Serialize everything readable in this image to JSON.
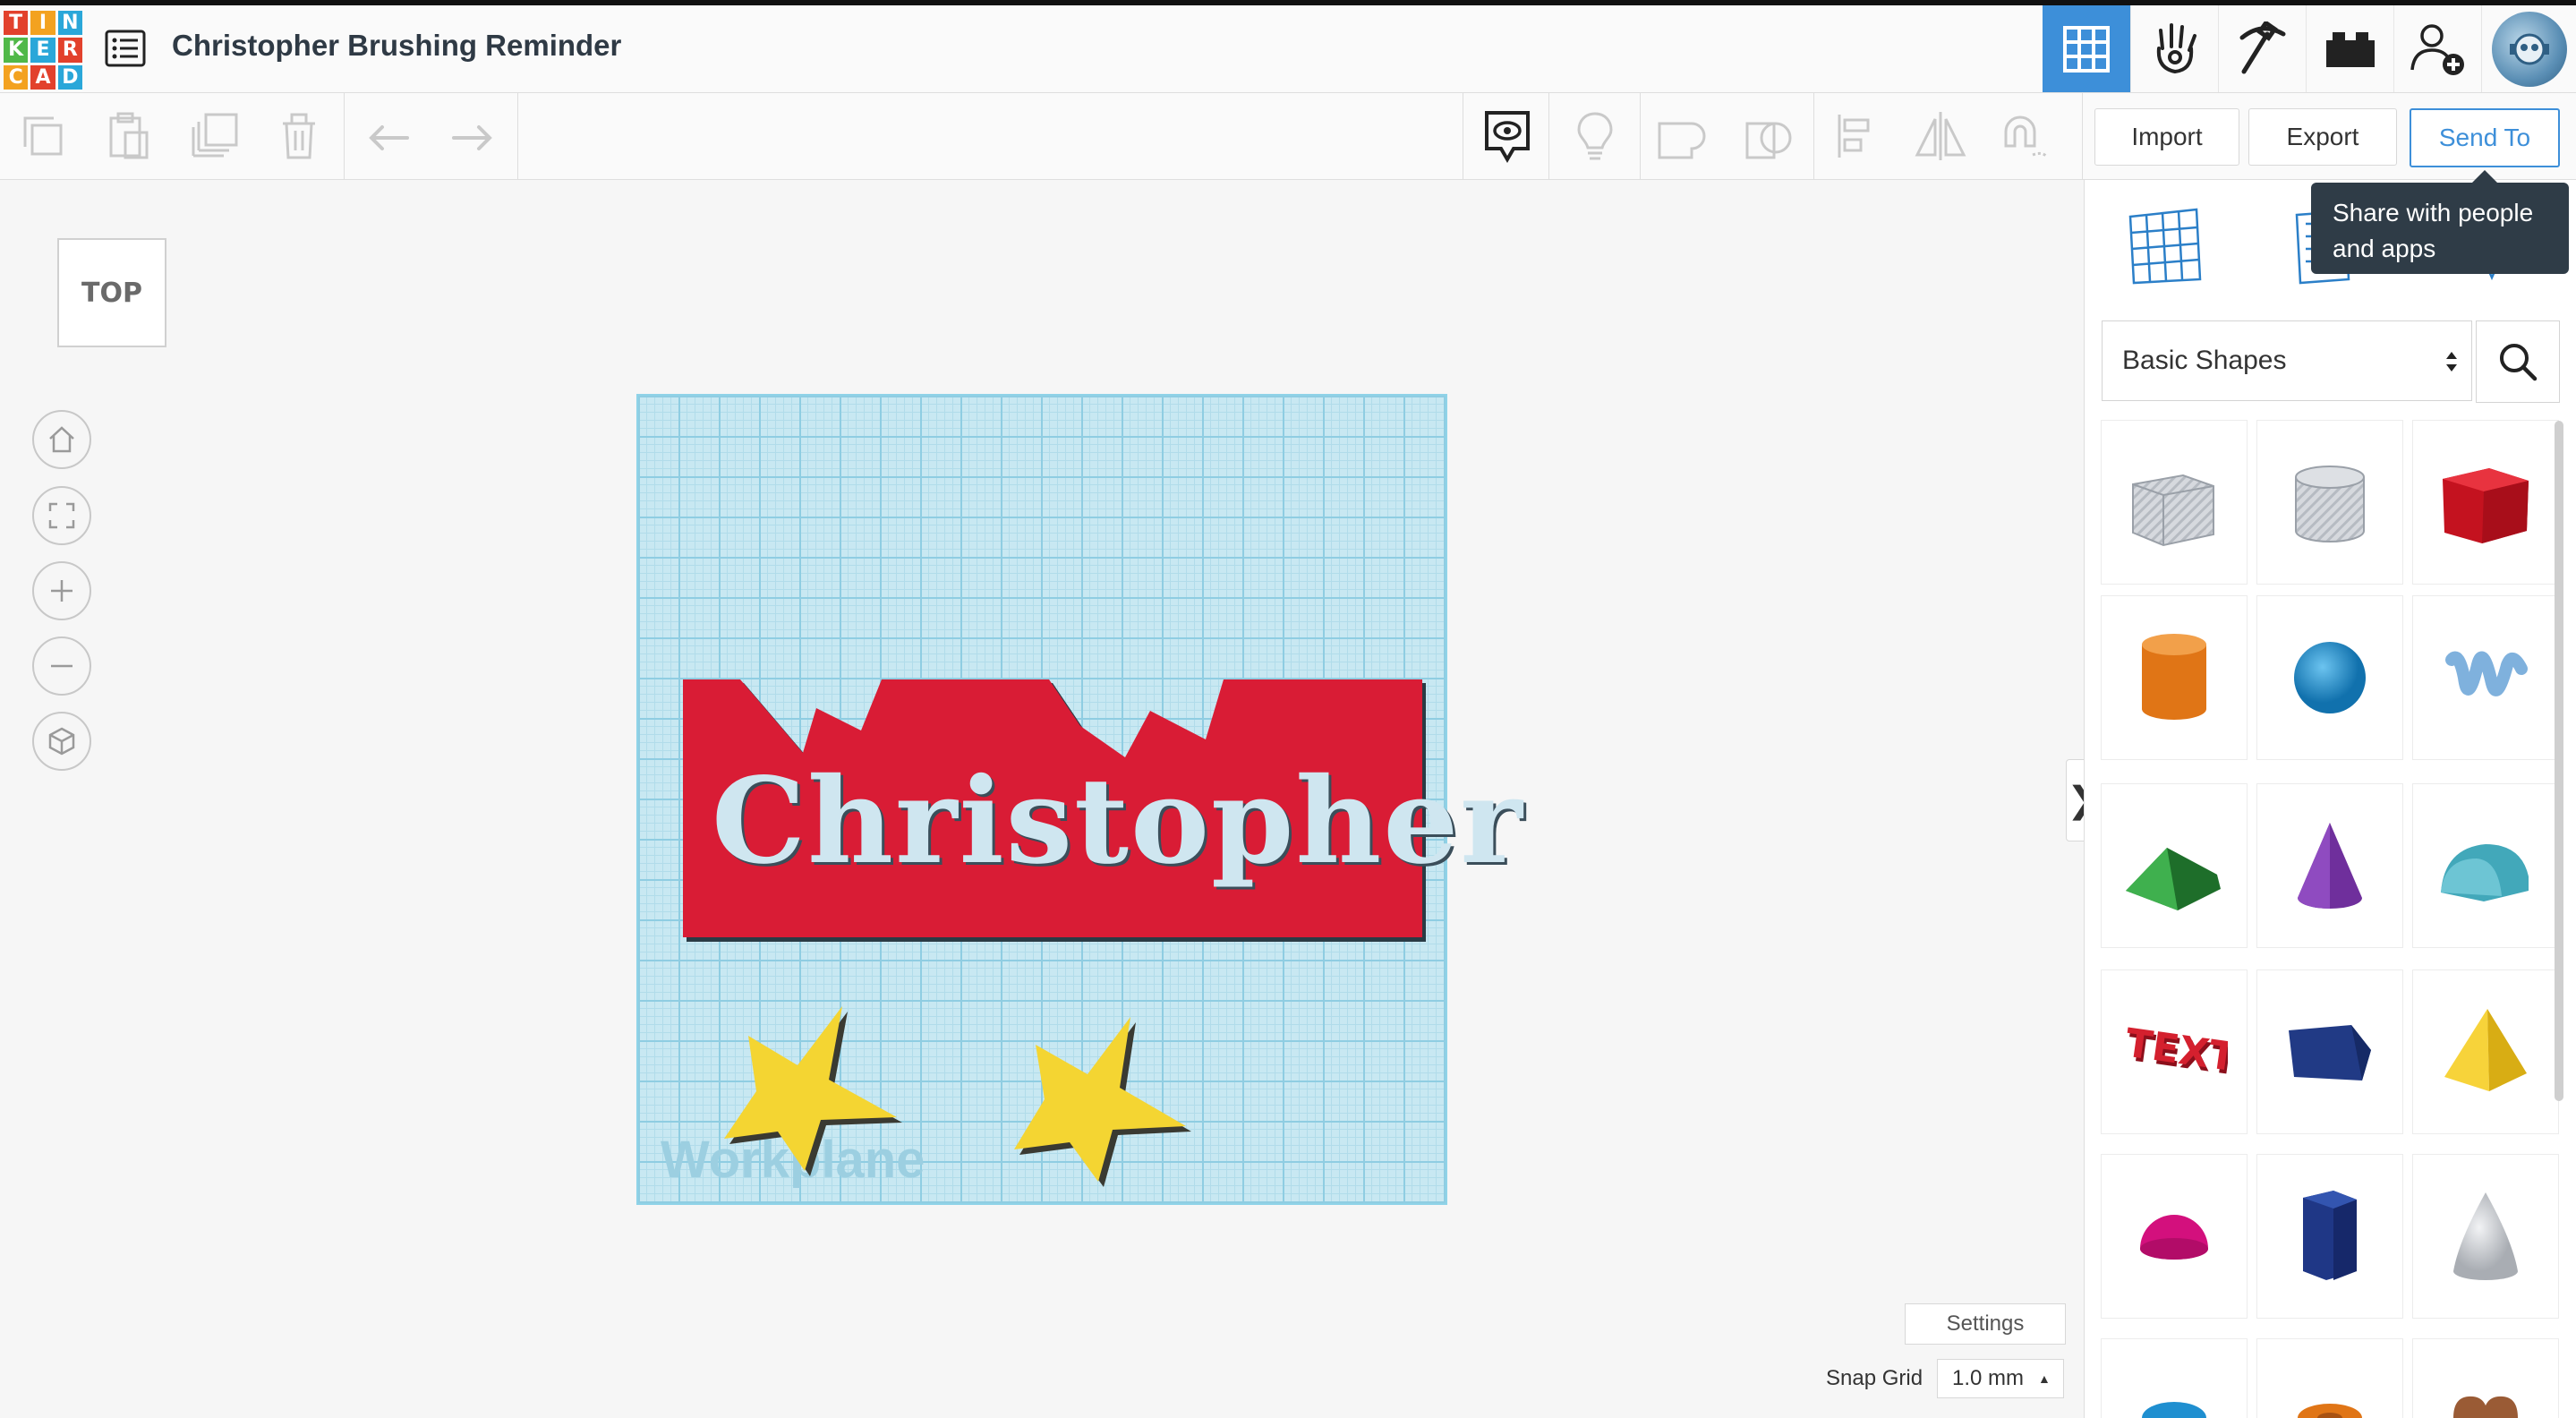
{
  "header": {
    "logo_letters": [
      "T",
      "I",
      "N",
      "K",
      "E",
      "R",
      "C",
      "A",
      "D"
    ],
    "logo_colors": [
      "#e2412c",
      "#f3a220",
      "#2aa7d9",
      "#50b848",
      "#2aa7d9",
      "#e2412c",
      "#f3a220",
      "#e2412c",
      "#2aa7d9"
    ],
    "design_title": "Christopher Brushing Reminder",
    "accent_color": "#3d8fd9"
  },
  "toolbar": {
    "import_label": "Import",
    "export_label": "Export",
    "send_to_label": "Send To",
    "tooltip_line1": "Share with people",
    "tooltip_line2": "and apps"
  },
  "canvas": {
    "view_cube_label": "TOP",
    "workplane_label": "Workplane",
    "design_text": "Christopher",
    "settings_label": "Settings",
    "snap_grid_label": "Snap Grid",
    "snap_grid_value": "1.0 mm"
  },
  "sidebar": {
    "category_selected": "Basic Shapes",
    "shapes": [
      {
        "name": "Box hole",
        "icon": "box-hole-icon",
        "color": "#c8ccd2"
      },
      {
        "name": "Cylinder hole",
        "icon": "cylinder-hole-icon",
        "color": "#c8ccd2"
      },
      {
        "name": "Box",
        "icon": "box-icon",
        "color": "#d4202e"
      },
      {
        "name": "Cylinder",
        "icon": "cylinder-icon",
        "color": "#e87b1e"
      },
      {
        "name": "Sphere",
        "icon": "sphere-icon",
        "color": "#1f8fd0"
      },
      {
        "name": "Scribble",
        "icon": "scribble-icon",
        "color": "#86b9e3"
      },
      {
        "name": "Roof",
        "icon": "roof-icon",
        "color": "#2f9e3f"
      },
      {
        "name": "Cone",
        "icon": "cone-icon",
        "color": "#7e3fa8"
      },
      {
        "name": "Round Roof",
        "icon": "round-roof-icon",
        "color": "#4fb7c9"
      },
      {
        "name": "Text",
        "icon": "text-shape-icon",
        "color": "#d4202e"
      },
      {
        "name": "Polygon",
        "icon": "polygon-icon",
        "color": "#27418f"
      },
      {
        "name": "Pyramid",
        "icon": "pyramid-icon",
        "color": "#f2c41d"
      },
      {
        "name": "Half Sphere",
        "icon": "half-sphere-icon",
        "color": "#e0158a"
      },
      {
        "name": "Hexagonal Prism",
        "icon": "hexagonal-prism-icon",
        "color": "#27418f"
      },
      {
        "name": "Paraboloid",
        "icon": "paraboloid-icon",
        "color": "#d3d5d8"
      },
      {
        "name": "Torus",
        "icon": "torus-icon",
        "color": "#1f8fd0"
      },
      {
        "name": "Tube",
        "icon": "tube-icon",
        "color": "#e87b1e"
      },
      {
        "name": "Heart",
        "icon": "heart-icon",
        "color": "#9a5b35"
      }
    ]
  }
}
